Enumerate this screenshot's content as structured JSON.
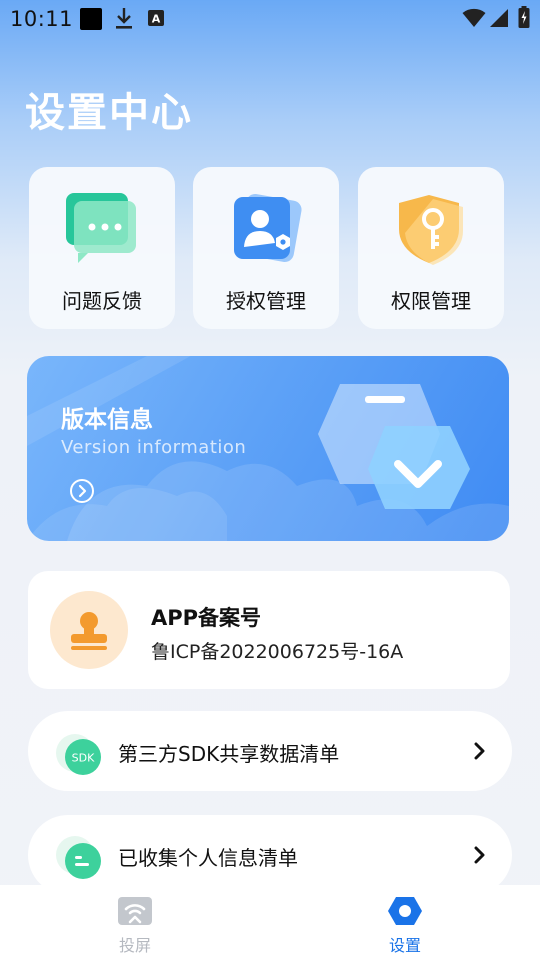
{
  "status_bar": {
    "time": "10:11"
  },
  "page": {
    "title": "设置中心"
  },
  "quick_actions": [
    {
      "label": "问题反馈",
      "icon": "chat-bubble-icon"
    },
    {
      "label": "授权管理",
      "icon": "user-auth-icon"
    },
    {
      "label": "权限管理",
      "icon": "shield-key-icon"
    }
  ],
  "version_card": {
    "title": "版本信息",
    "subtitle": "Version information"
  },
  "record": {
    "title": "APP备案号",
    "value": "鲁ICP备2022006725号-16A"
  },
  "list": [
    {
      "label": "第三方SDK共享数据清单",
      "icon_text": "SDK"
    },
    {
      "label": "已收集个人信息清单"
    }
  ],
  "bottom_nav": [
    {
      "label": "投屏",
      "active": false
    },
    {
      "label": "设置",
      "active": true
    }
  ],
  "colors": {
    "accent": "#1a73e8",
    "inactive": "#b5b9c0",
    "version_bg": "#5ea2f7",
    "record_orange": "#f39a2e"
  }
}
